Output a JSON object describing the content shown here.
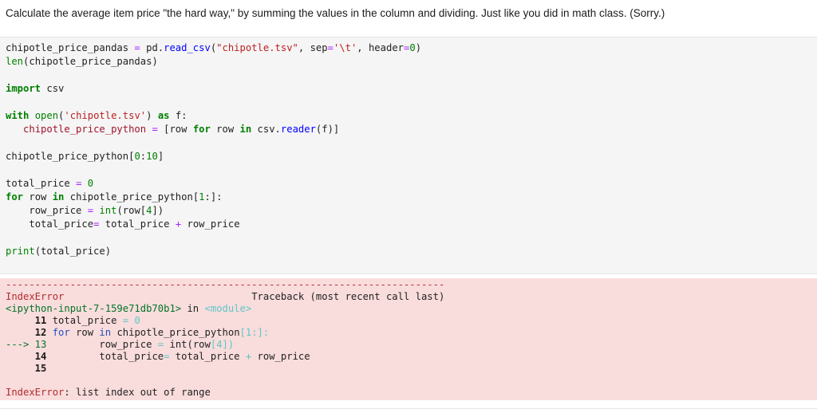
{
  "intro_text": "Calculate the average item price \"the hard way,\" by summing the values in the column and dividing. Just like you did in math class. (Sorry.)",
  "code": {
    "l1_var": "chipotle_price_pandas",
    "l1_eq": " = ",
    "l1_pd": "pd.",
    "l1_fn": "read_csv",
    "l1_open": "(",
    "l1_str": "\"chipotle.tsv\"",
    "l1_sep_kw": ", sep",
    "l1_sep_eq": "=",
    "l1_sep_val": "'\\t'",
    "l1_hdr_kw": ", header",
    "l1_hdr_eq": "=",
    "l1_hdr_val": "0",
    "l1_close": ")",
    "l2_len": "len",
    "l2_rest": "(chipotle_price_pandas)",
    "l4_import": "import",
    "l4_mod": " csv",
    "l6_with": "with",
    "l6_open": " open",
    "l6_p1": "(",
    "l6_str": "'chipotle.tsv'",
    "l6_p2": ") ",
    "l6_as": "as",
    "l6_f": " f:",
    "l7_indent": "   ",
    "l7_var": "chipotle_price_python",
    "l7_eq": " = ",
    "l7_b1": "[row ",
    "l7_for": "for",
    "l7_row": " row ",
    "l7_in": "in",
    "l7_csv": " csv.",
    "l7_reader": "reader",
    "l7_end": "(f)]",
    "l9": "chipotle_price_python[",
    "l9_n1": "0",
    "l9_mid": ":",
    "l9_n2": "10",
    "l9_end": "]",
    "l11_a": "total_price ",
    "l11_eq": "=",
    "l11_sp": " ",
    "l11_n": "0",
    "l12_for": "for",
    "l12_row": " row ",
    "l12_in": "in",
    "l12_rest": " chipotle_price_python[",
    "l12_n": "1",
    "l12_end": ":]:",
    "l13_indent": "    ",
    "l13_a": "row_price ",
    "l13_eq": "=",
    "l13_sp": " ",
    "l13_int": "int",
    "l13_b": "(row[",
    "l13_n": "4",
    "l13_end": "])",
    "l14_indent": "    ",
    "l14_a": "total_price",
    "l14_eq": "=",
    "l14_b": " total_price ",
    "l14_plus": "+",
    "l14_c": " row_price",
    "l16_print": "print",
    "l16_rest": "(total_price)"
  },
  "error": {
    "dashes": "---------------------------------------------------------------------------",
    "name": "IndexError",
    "traceback_pad": "                                ",
    "traceback": "Traceback (most recent call last)",
    "input": "<ipython-input-7-159e71db70b1>",
    "in_word": " in ",
    "module": "<module>",
    "t11_num": "     11",
    "t11_a": " total_price ",
    "t11_eq": "=",
    "t11_n": " 0",
    "t12_num": "     12",
    "t12_for": " for",
    "t12_row": " row ",
    "t12_in": "in",
    "t12_rest": " chipotle_price_python",
    "t12_br": "[1:]:",
    "t13_arrow": "---> 13",
    "t13_a": "         row_price ",
    "t13_eq": "=",
    "t13_int": " int",
    "t13_b": "(row",
    "t13_br": "[4])",
    "t14_num": "     14",
    "t14_a": "         total_price",
    "t14_eq": "=",
    "t14_b": " total_price ",
    "t14_plus": "+",
    "t14_c": " row_price",
    "t15_num": "     15",
    "final_name": "IndexError",
    "final_msg": ": list index out of range"
  }
}
